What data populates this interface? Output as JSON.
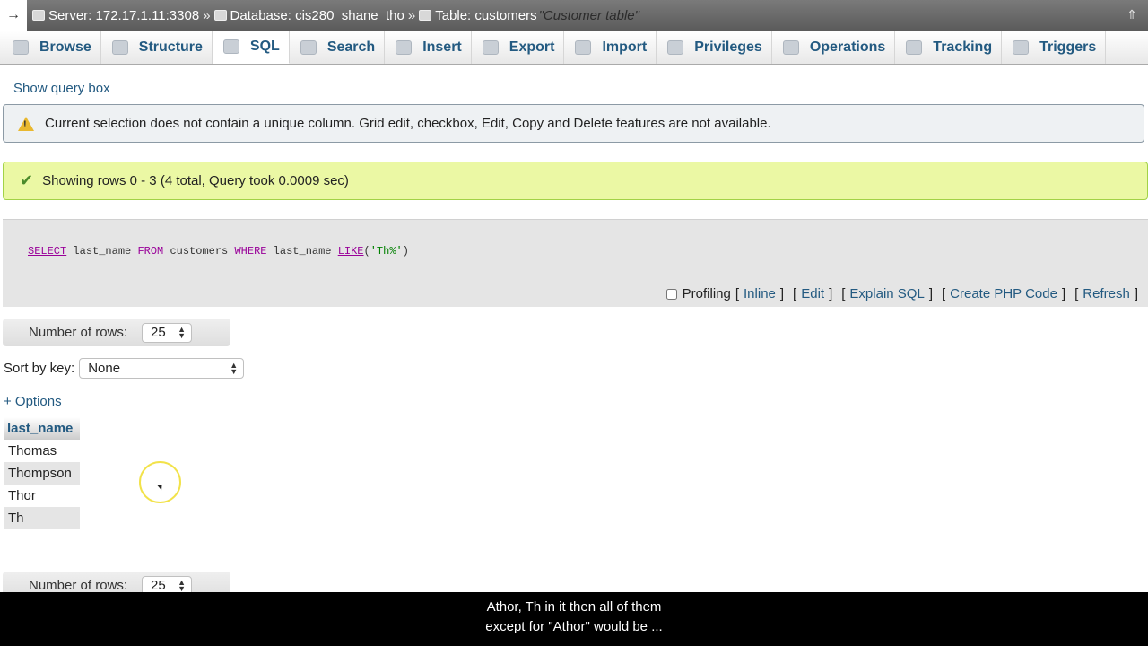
{
  "breadcrumb": {
    "back_arrow": "→",
    "server": "Server: 172.17.1.11:3308",
    "sep1": "»",
    "database": "Database: cis280_shane_tho",
    "sep2": "»",
    "table": "Table: customers",
    "table_comment": "\"Customer table\"",
    "collapse": "⇑"
  },
  "tabs": [
    {
      "label": "Browse",
      "icon": "browse-icon"
    },
    {
      "label": "Structure",
      "icon": "structure-icon"
    },
    {
      "label": "SQL",
      "icon": "sql-icon",
      "active": true
    },
    {
      "label": "Search",
      "icon": "search-icon"
    },
    {
      "label": "Insert",
      "icon": "insert-icon"
    },
    {
      "label": "Export",
      "icon": "export-icon"
    },
    {
      "label": "Import",
      "icon": "import-icon"
    },
    {
      "label": "Privileges",
      "icon": "privileges-icon"
    },
    {
      "label": "Operations",
      "icon": "wrench-icon"
    },
    {
      "label": "Tracking",
      "icon": "eye-icon"
    },
    {
      "label": "Triggers",
      "icon": "triggers-icon"
    }
  ],
  "show_query_box": "Show query box",
  "notice": {
    "icon": "warning-icon",
    "text": "Current selection does not contain a unique column. Grid edit, checkbox, Edit, Copy and Delete features are not available."
  },
  "success": {
    "icon": "check-icon",
    "text": "Showing rows 0 - 3 (4 total, Query took 0.0009 sec)"
  },
  "sql": {
    "select": "SELECT",
    "col": " last_name ",
    "from": "FROM",
    "table": " customers ",
    "where": "WHERE",
    "col2": " last_name ",
    "like": "LIKE",
    "arg_open": "(",
    "arg": "'Th%'",
    "arg_close": ")"
  },
  "sql_toolbar": {
    "profiling": "Profiling",
    "open1": "[",
    "inline": "Inline",
    "close1": "]",
    "open2": "[",
    "edit": "Edit",
    "close2": "]",
    "open3": "[",
    "explain": "Explain SQL",
    "close3": "]",
    "open4": "[",
    "php": "Create PHP Code",
    "close4": "]",
    "open5": "[",
    "refresh": "Refresh",
    "close5": "]"
  },
  "nav_top": {
    "label": "Number of rows:",
    "value": "25"
  },
  "sort_by": {
    "label": "Sort by key:",
    "value": "None"
  },
  "options_link": "+ Options",
  "results": {
    "header": "last_name",
    "rows": [
      "Thomas",
      "Thompson",
      "Thor",
      "Th"
    ]
  },
  "nav_bottom": {
    "label": "Number of rows:",
    "value": "25"
  },
  "caption": {
    "line1": "Athor, Th in it then all of them",
    "line2": "except for \"Athor\" would be ..."
  }
}
